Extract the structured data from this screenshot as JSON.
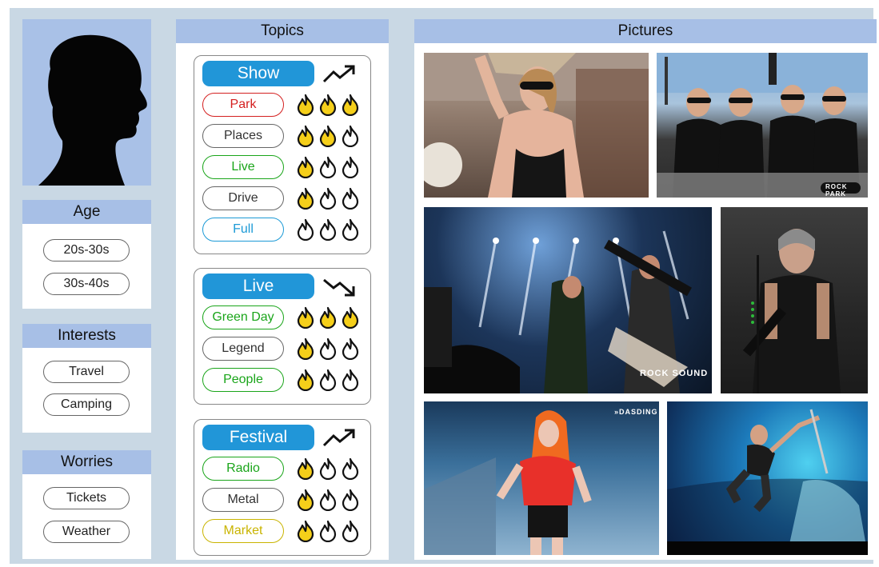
{
  "profile": {
    "avatar_icon": "person-silhouette-icon"
  },
  "age": {
    "title": "Age",
    "items": [
      "20s-30s",
      "30s-40s"
    ]
  },
  "interests": {
    "title": "Interests",
    "items": [
      "Travel",
      "Camping"
    ]
  },
  "worries": {
    "title": "Worries",
    "items": [
      "Tickets",
      "Weather"
    ]
  },
  "topics": {
    "title": "Topics",
    "groups": [
      {
        "label": "Show",
        "trend": "up",
        "items": [
          {
            "label": "Park",
            "color": "#d42020",
            "border": "#d42020",
            "flames": 3
          },
          {
            "label": "Places",
            "color": "#333333",
            "border": "#666666",
            "flames": 2
          },
          {
            "label": "Live",
            "color": "#1aa51a",
            "border": "#1aa51a",
            "flames": 1
          },
          {
            "label": "Drive",
            "color": "#333333",
            "border": "#666666",
            "flames": 1
          },
          {
            "label": "Full",
            "color": "#1c9ad6",
            "border": "#1c9ad6",
            "flames": 0
          }
        ]
      },
      {
        "label": "Live",
        "trend": "down",
        "items": [
          {
            "label": "Green Day",
            "color": "#1aa51a",
            "border": "#1aa51a",
            "flames": 3
          },
          {
            "label": "Legend",
            "color": "#333333",
            "border": "#666666",
            "flames": 1
          },
          {
            "label": "People",
            "color": "#1aa51a",
            "border": "#1aa51a",
            "flames": 1
          }
        ]
      },
      {
        "label": "Festival",
        "trend": "up",
        "items": [
          {
            "label": "Radio",
            "color": "#1aa51a",
            "border": "#1aa51a",
            "flames": 1
          },
          {
            "label": "Metal",
            "color": "#333333",
            "border": "#666666",
            "flames": 1
          },
          {
            "label": "Market",
            "color": "#c9b400",
            "border": "#c9b400",
            "flames": 1
          }
        ]
      }
    ]
  },
  "pictures": {
    "title": "Pictures",
    "logos": {
      "rockpark": "ROCK PARK",
      "rocksound": "ROCK SOUND",
      "dasding": "»DASDING"
    }
  },
  "colors": {
    "header": "#a7bfe6",
    "accent": "#2196d8",
    "flame_on": "#f5cf1a",
    "background": "#c9d8e4"
  }
}
